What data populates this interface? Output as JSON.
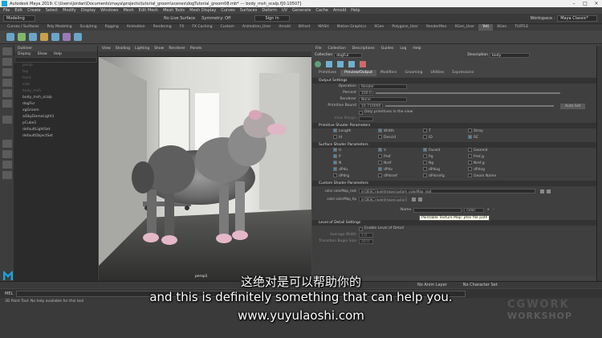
{
  "window": {
    "title": "Autodesk Maya 2019: C:\\Users\\jordan\\Documents\\maya\\projects\\tutorial_groom\\scenes\\dogTutorial_groom08.mb* --- body_msh_scalp.f[0:10507]"
  },
  "menubar": [
    "File",
    "Edit",
    "Create",
    "Select",
    "Modify",
    "Display",
    "Windows",
    "Mesh",
    "Edit Mesh",
    "Mesh Tools",
    "Mesh Display",
    "Curves",
    "Surfaces",
    "Deform",
    "UV",
    "Generate",
    "Cache",
    "Arnold",
    "Help"
  ],
  "status": {
    "mode": "Modeling",
    "live": "No Live Surface",
    "symmetry": "Symmetry: Off",
    "signin": "Sign In",
    "workspace_label": "Workspace :",
    "workspace": "Maya Classic*"
  },
  "shelf_tabs": [
    "Curves / Surfaces",
    "Poly Modeling",
    "Sculpting",
    "Rigging",
    "Animation",
    "Rendering",
    "FX",
    "FX Caching",
    "Custom",
    "Animation_User",
    "Arnold",
    "Bifrost",
    "MASH",
    "Motion Graphics",
    "XGen",
    "Polygons_User",
    "RenderMan",
    "XGen_User",
    "Yeti",
    "XGen",
    "TURTLE"
  ],
  "active_shelf_tab": "Yeti",
  "outliner": {
    "title": "Outliner",
    "menu": [
      "Display",
      "Show",
      "Help"
    ],
    "items": [
      {
        "label": "persp",
        "dim": true
      },
      {
        "label": "top",
        "dim": true
      },
      {
        "label": "front",
        "dim": true
      },
      {
        "label": "side",
        "dim": true
      },
      {
        "label": "body_msh",
        "dim": true
      },
      {
        "label": "body_msh_scalp",
        "dim": false
      },
      {
        "label": "dogFur",
        "dim": false
      },
      {
        "label": "xgGroom",
        "dim": false
      },
      {
        "label": "aiSkyDomeLight1",
        "dim": false
      },
      {
        "label": "pCube1",
        "dim": false
      },
      {
        "label": "defaultLightSet",
        "dim": false
      },
      {
        "label": "defaultObjectSet",
        "dim": false
      }
    ]
  },
  "viewport": {
    "menu": [
      "View",
      "Shading",
      "Lighting",
      "Show",
      "Renderer",
      "Panels"
    ],
    "camera": "persp1"
  },
  "attr_editor": {
    "menu": [
      "File",
      "Collection",
      "Descriptions",
      "Guides",
      "Log",
      "Help"
    ],
    "collection_label": "Collection",
    "collection": "dogFur",
    "description_label": "Description",
    "description": "body",
    "tabs": [
      "Primitives",
      "Preview/Output",
      "Modifiers",
      "Grooming",
      "Utilities",
      "Expressions"
    ],
    "active_tab": "Preview/Output",
    "sections": {
      "output": "Output Settings",
      "operation_label": "Operation",
      "operation": "Render",
      "percent_label": "Percent",
      "percent": "100.0",
      "renderer_label": "Renderer",
      "renderer": "None",
      "primitive_bound_label": "Primitive Bound",
      "primitive_bound": "10.710000",
      "auto_set": "Auto Set",
      "only_primitives": "Only primitives in the view",
      "view_margin_label": "View Margin",
      "prim_shader": "Primitive Shader Parameters",
      "prim_params": [
        "Length",
        "Width",
        "T",
        "Stray",
        "Id",
        "Descid",
        "ID",
        "RE"
      ],
      "surface_shader": "Surface Shader Parameters",
      "surface_params": [
        "U",
        "V",
        "Faceid",
        "Geomid",
        "P",
        "Pref",
        "Pg",
        "Pref,g",
        "N",
        "Nref",
        "Ng",
        "Nref,g",
        "dPdu",
        "dPdv",
        "dPdug",
        "dPdvg",
        "dPdrg",
        "dPdsref",
        "dPdsrefg",
        "Geom Name"
      ],
      "custom_shader": "Custom Shader Parameters",
      "custom_rows": [
        {
          "label": "color colorMap_root",
          "value": "${DESC}/paintmaps/custom_colorMap_root"
        },
        {
          "label": "color colorMap_tip",
          "value": "${DESC}/paintmaps/custom_color"
        }
      ],
      "tooltip": "Paintable Texture Map: ptex file path",
      "name_label": "Name",
      "name_type": "color",
      "lod": "Level of Detail Settings",
      "enable_lod": "Enable Level of Detail",
      "avg_width_label": "Average Width",
      "avg_width": "1.0",
      "transition_label": "Transition Begin Size",
      "transition": "20.0"
    }
  },
  "timeline": {
    "anim_layer": "No Anim Layer",
    "char_set": "No Character Set"
  },
  "cmdline": {
    "label": "MEL"
  },
  "helpline": {
    "text": "3D Paint Tool: No help available for this tool"
  },
  "subtitles": {
    "chinese": "这绝对是可以帮助你的",
    "english": "and this is definitely something that can help you.",
    "url": "www.yuyulaoshi.com"
  },
  "watermark": {
    "line1": "CGWORK",
    "line2": "WORKSHOP"
  },
  "colors": {
    "accent": "#5285a6",
    "maya_blue": "#1aa5dd"
  }
}
